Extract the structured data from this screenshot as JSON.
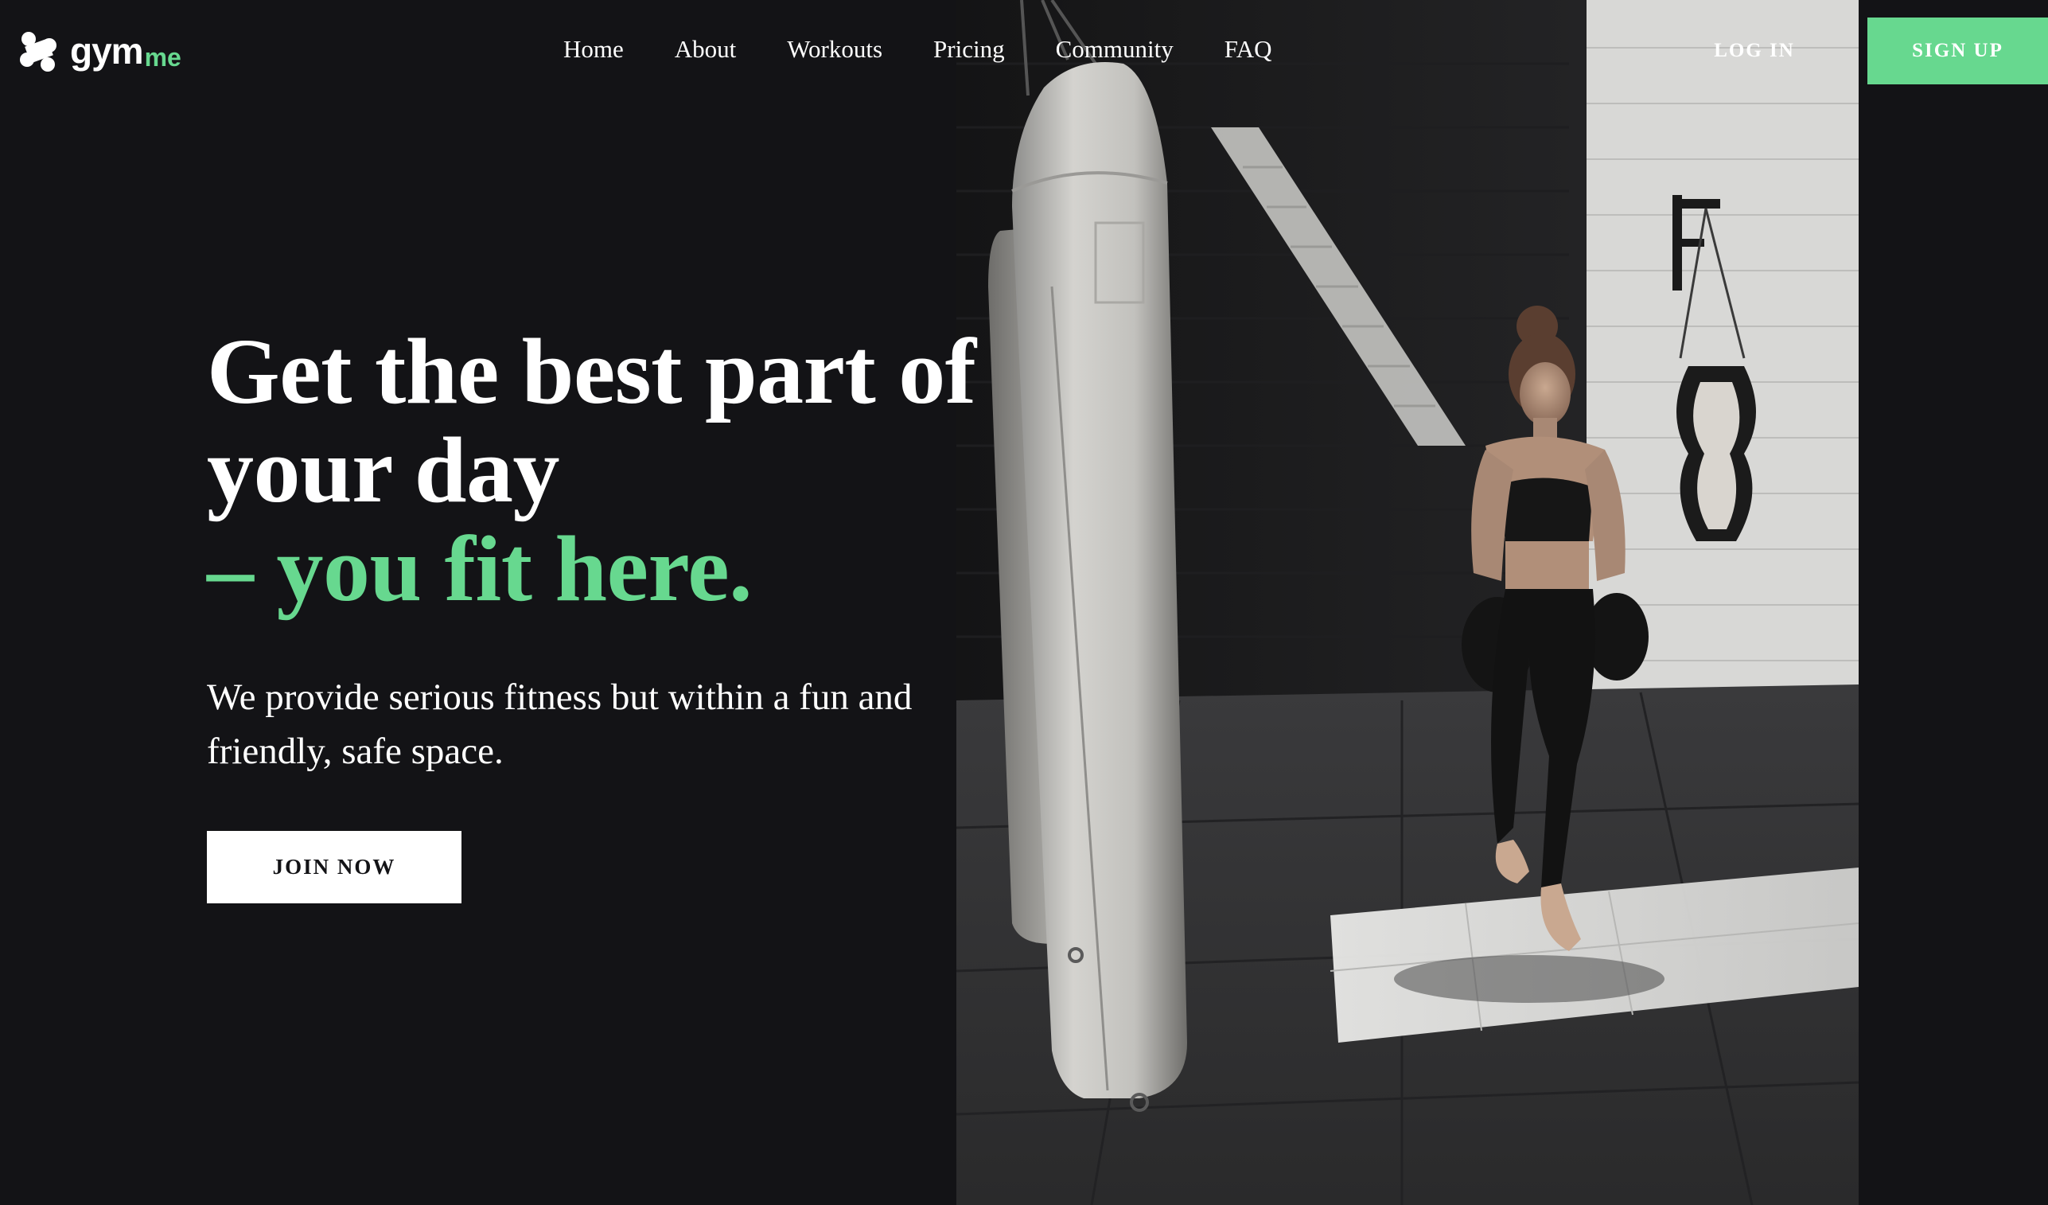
{
  "brand": {
    "name": "gym",
    "suffix": "me",
    "accent_color": "#67d88f",
    "icon": "gymme-logo-icon"
  },
  "nav": {
    "items": [
      {
        "label": "Home"
      },
      {
        "label": "About"
      },
      {
        "label": "Workouts"
      },
      {
        "label": "Pricing"
      },
      {
        "label": "Community"
      },
      {
        "label": "FAQ"
      }
    ],
    "login_label": "LOG IN",
    "signup_label": "SIGN UP"
  },
  "hero": {
    "headline_line1": "Get the best part of",
    "headline_line2": "your day",
    "headline_accent": "– you fit here.",
    "subtext": "We provide serious fitness but within a fun and friendly, safe space.",
    "cta_label": "JOIN NOW",
    "image": "boxing-gym-photo"
  },
  "colors": {
    "background": "#131316",
    "accent": "#67d88f",
    "text": "#ffffff"
  }
}
